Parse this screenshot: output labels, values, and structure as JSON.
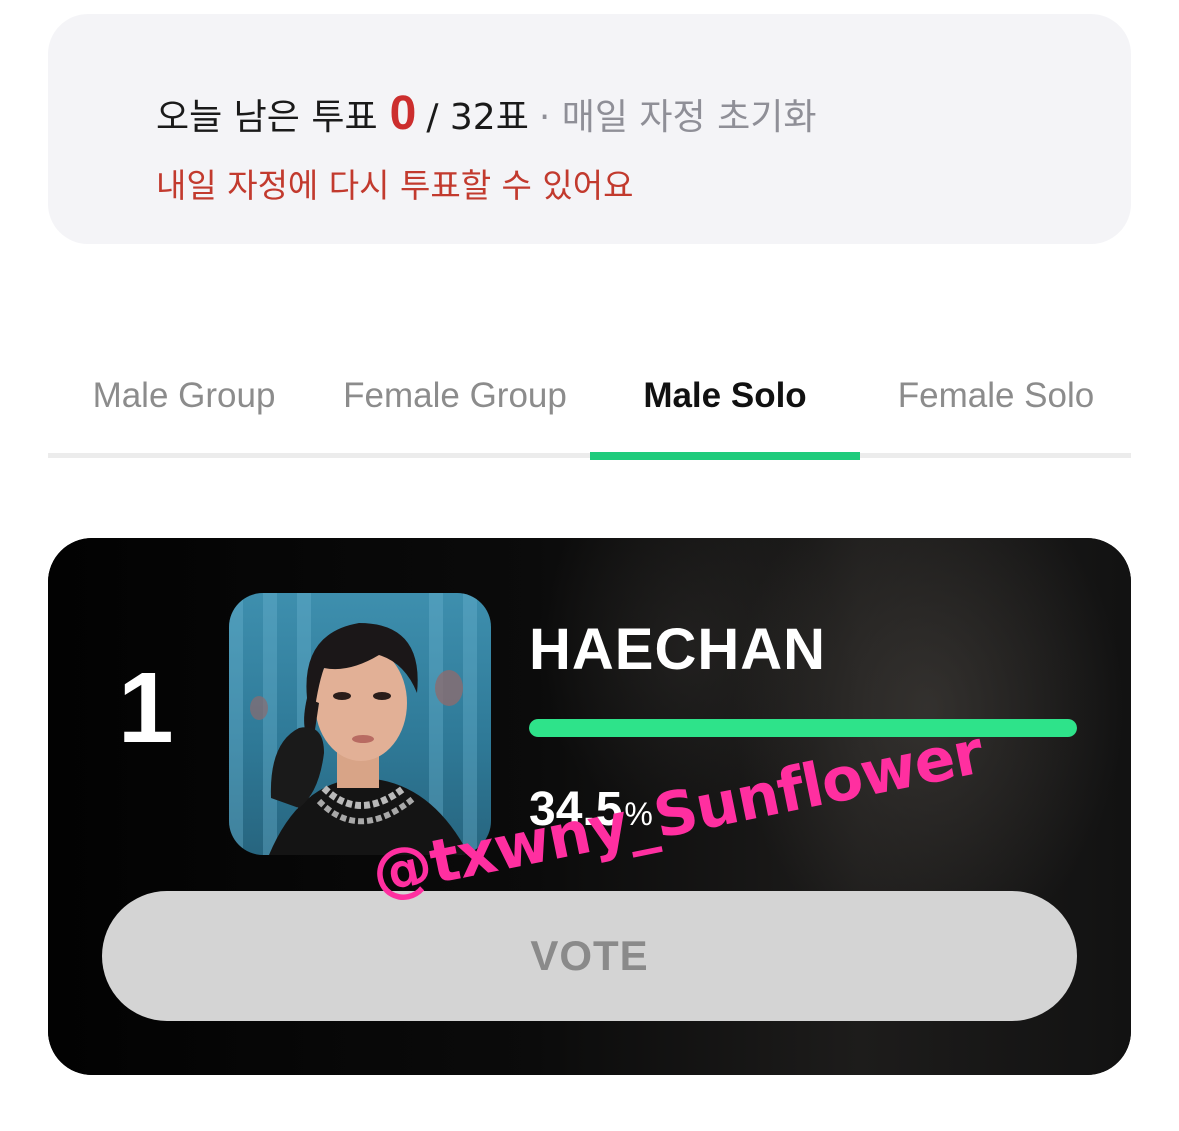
{
  "vote_info": {
    "label": "오늘 남은 투표",
    "remaining": "0",
    "total": "/ 32표",
    "reset_note": "· 매일 자정 초기화",
    "message": "내일 자정에 다시 투표할 수 있어요"
  },
  "tabs": [
    {
      "label": "Male Group",
      "active": false
    },
    {
      "label": "Female Group",
      "active": false
    },
    {
      "label": "Male Solo",
      "active": true
    },
    {
      "label": "Female Solo",
      "active": false
    }
  ],
  "ranking": {
    "rank": "1",
    "name": "HAECHAN",
    "percent_value": "34.5",
    "percent_unit": "%",
    "progress_fraction": 1.0,
    "vote_label": "VOTE"
  },
  "watermark": "@txwny_Sunflower",
  "colors": {
    "accent": "#1fcb7c",
    "progress": "#2ee38a",
    "remaining": "#cc2e2e",
    "message": "#c23a2e",
    "watermark": "#ff2fa0"
  }
}
